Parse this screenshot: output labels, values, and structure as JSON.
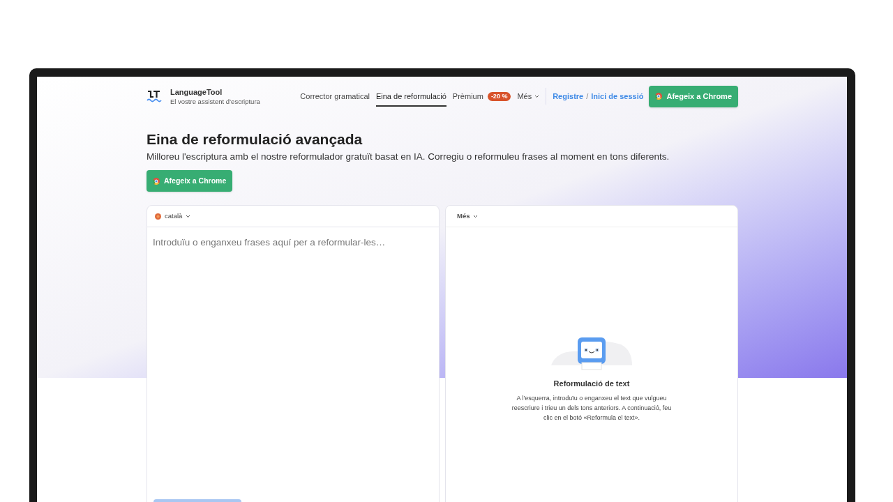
{
  "header": {
    "brand": "LanguageTool",
    "tagline": "El vostre assistent d’escriptura",
    "nav": [
      {
        "label": "Corrector gramatical",
        "selected": false
      },
      {
        "label": "Eina de reformulació",
        "selected": true
      },
      {
        "label": "Prèmium",
        "selected": false,
        "badge": "-20 %"
      },
      {
        "label": "Més",
        "selected": false,
        "dropdown": true
      }
    ],
    "register": "Registre",
    "separator": "/",
    "login": "Inici de sessió",
    "cta": "Afegeix a Chrome"
  },
  "hero": {
    "title": "Eina de reformulació avançada",
    "subtitle": "Milloreu l'escriptura amb el nostre reformulador gratuït basat en IA. Corregiu o reformuleu frases al moment en tons diferents.",
    "cta": "Afegeix a Chrome"
  },
  "input_panel": {
    "language": "català",
    "placeholder": "Introduïu o enganxeu frases aquí per a reformular-les…"
  },
  "output_panel": {
    "menu": "Més",
    "empty_title": "Reformulació de text",
    "empty_text": "A l'esquerra, introduïu o enganxeu el text que vulgueu reescriure i trieu un dels tons anteriors. A continuació, feu clic en el botó «Reformula el text»."
  }
}
